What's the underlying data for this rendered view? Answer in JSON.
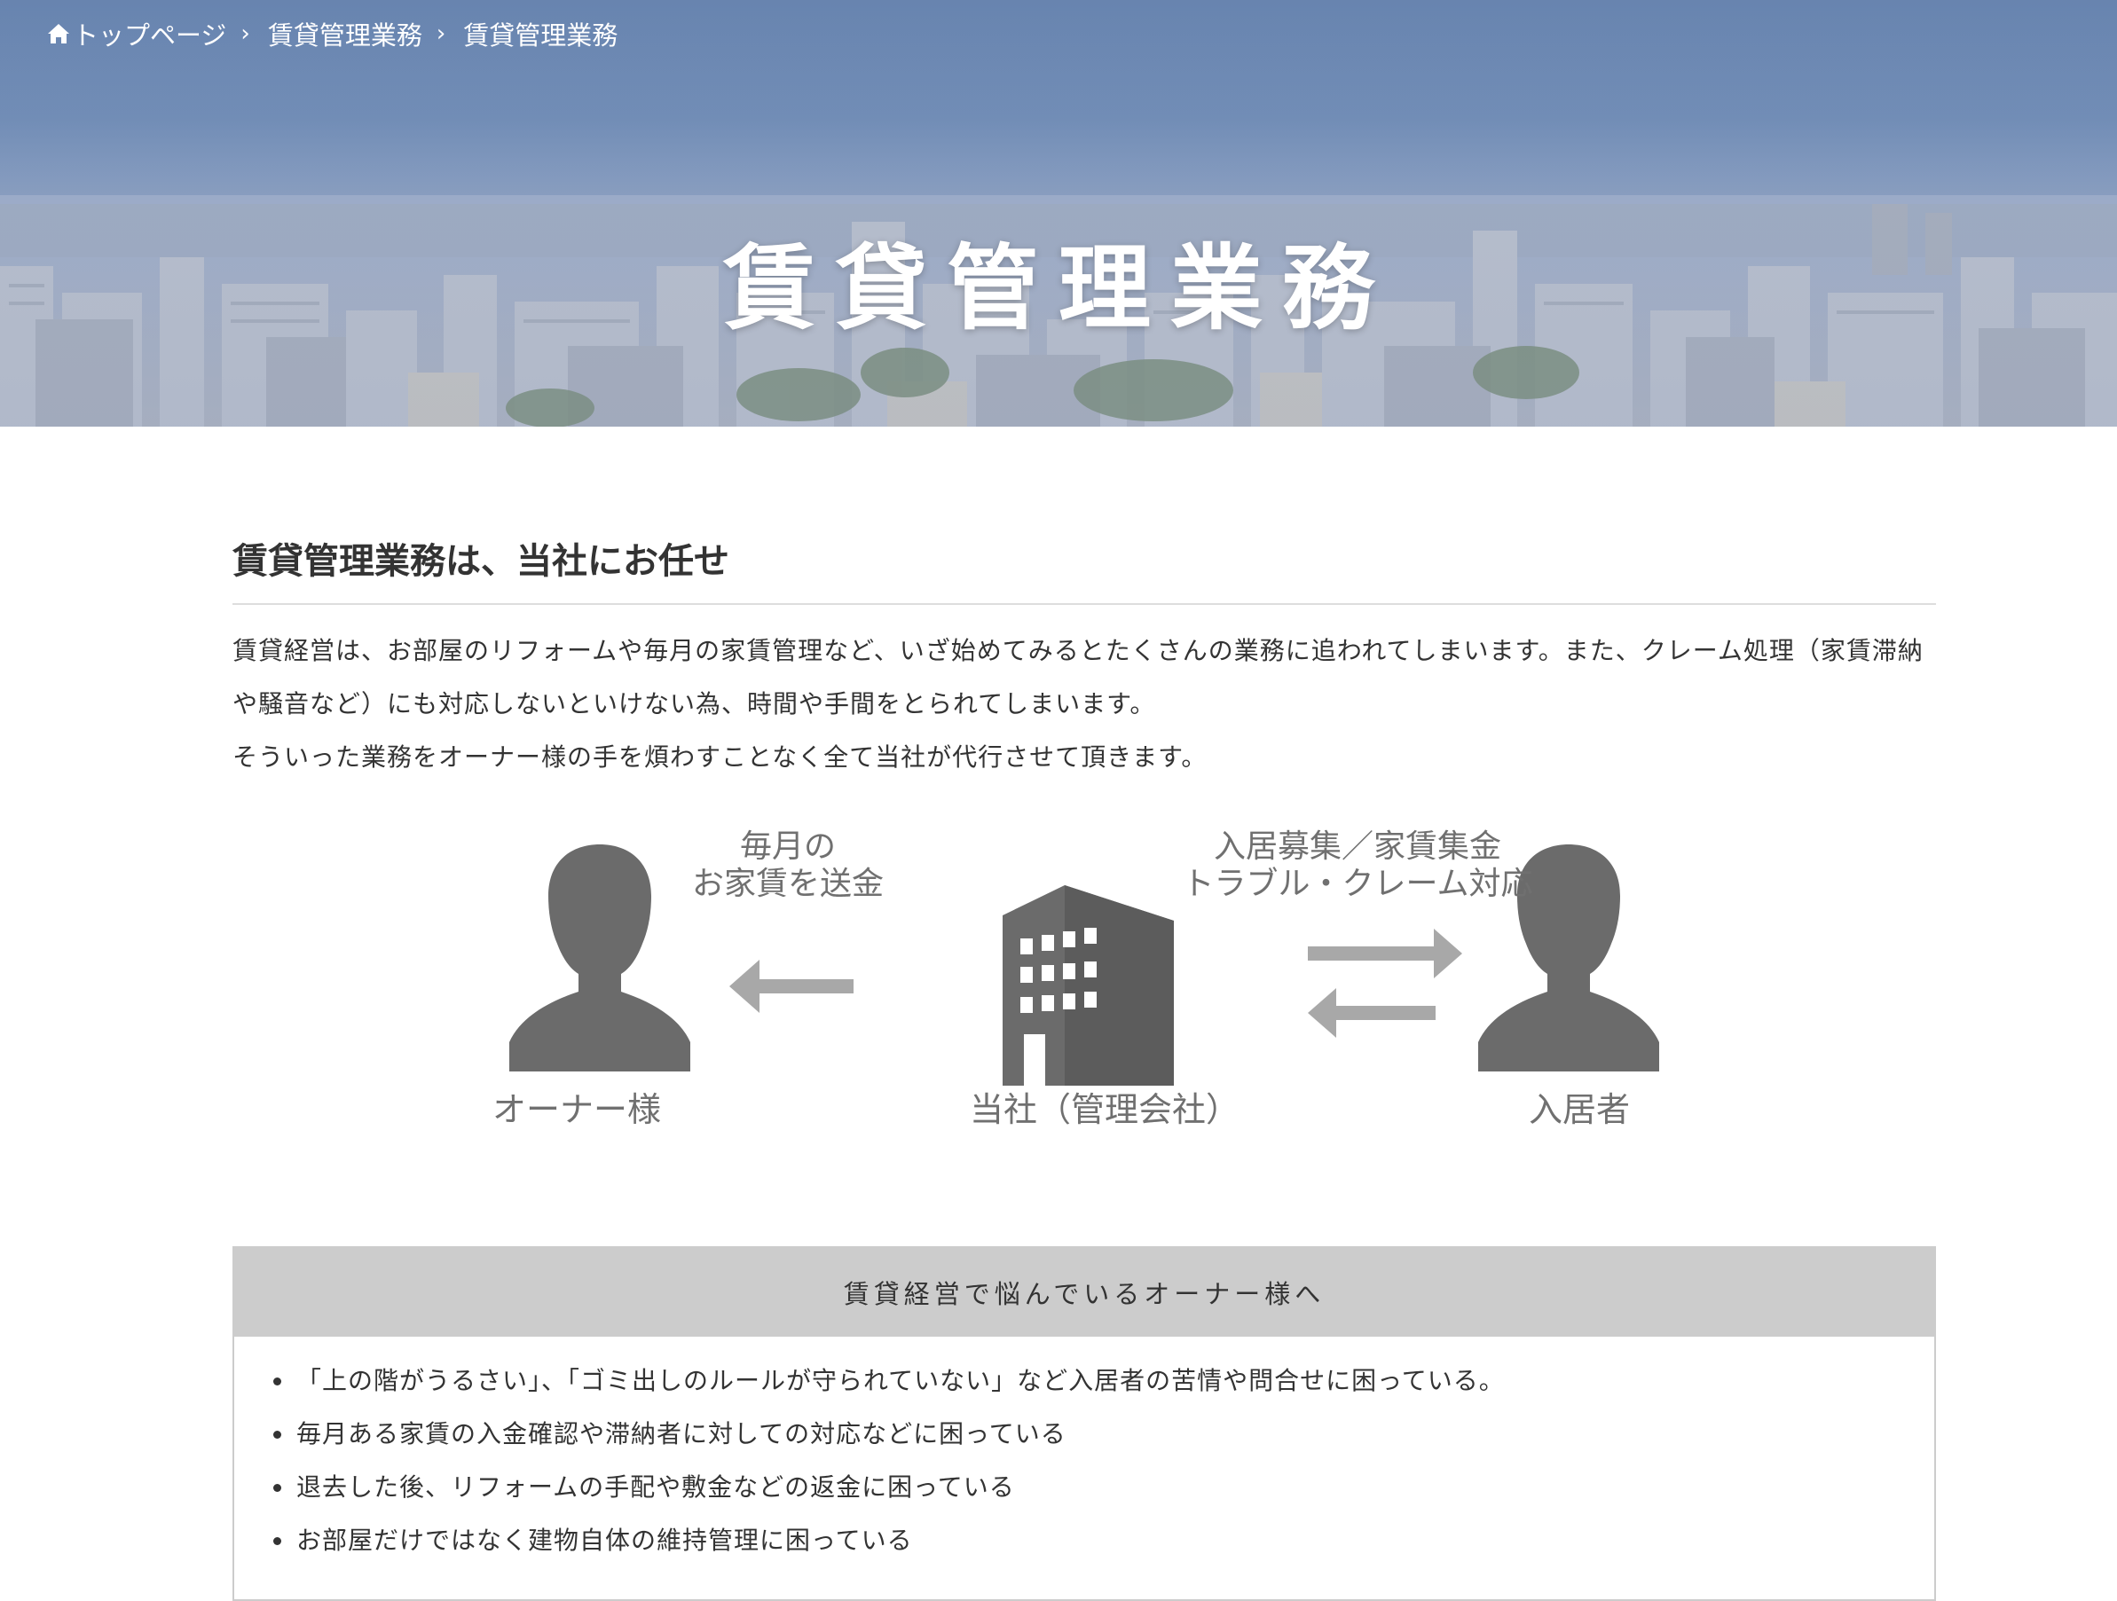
{
  "breadcrumb": {
    "home_label": "トップページ",
    "items": [
      "賃貸管理業務",
      "賃貸管理業務"
    ],
    "separator": "›"
  },
  "hero": {
    "title": "賃貸管理業務"
  },
  "section": {
    "heading": "賃貸管理業務は、当社にお任せ",
    "paragraphs": [
      "賃貸経営は、お部屋のリフォームや毎月の家賃管理など、いざ始めてみるとたくさんの業務に追われてしまいます。また、クレーム処理（家賃滞納や騒音など）にも対応しないといけない為、時間や手間をとられてしまいます。",
      "そういった業務をオーナー様の手を煩わすことなく全て当社が代行させて頂きます。"
    ]
  },
  "diagram": {
    "owner_label": "オーナー様",
    "company_label": "当社（管理会社）",
    "tenant_label": "入居者",
    "rent_caption_line1": "毎月の",
    "rent_caption_line2": "お家賃を送金",
    "services_caption_line1": "入居募集／家賃集金",
    "services_caption_line2": "トラブル・クレーム対応"
  },
  "concerns": {
    "header": "賃貸経営で悩んでいるオーナー様へ",
    "items": [
      "「上の階がうるさい」、「ゴミ出しのルールが守られていない」など入居者の苦情や問合せに困っている。",
      "毎月ある家賃の入金確認や滞納者に対しての対応などに困っている",
      "退去した後、リフォームの手配や敷金などの返金に困っている",
      "お部屋だけではなく建物自体の維持管理に困っている"
    ]
  },
  "colors": {
    "hero_sky": "#6a86b0",
    "icon_gray": "#6b6b6b",
    "arrow_gray": "#a8a8a8",
    "concerns_header_bg": "#cccccc",
    "text": "#333333"
  },
  "icons": {
    "home": "home-icon",
    "person": "person-silhouette-icon",
    "building": "building-icon",
    "arrow_left": "arrow-left-icon",
    "arrow_exchange": "exchange-arrows-icon"
  }
}
